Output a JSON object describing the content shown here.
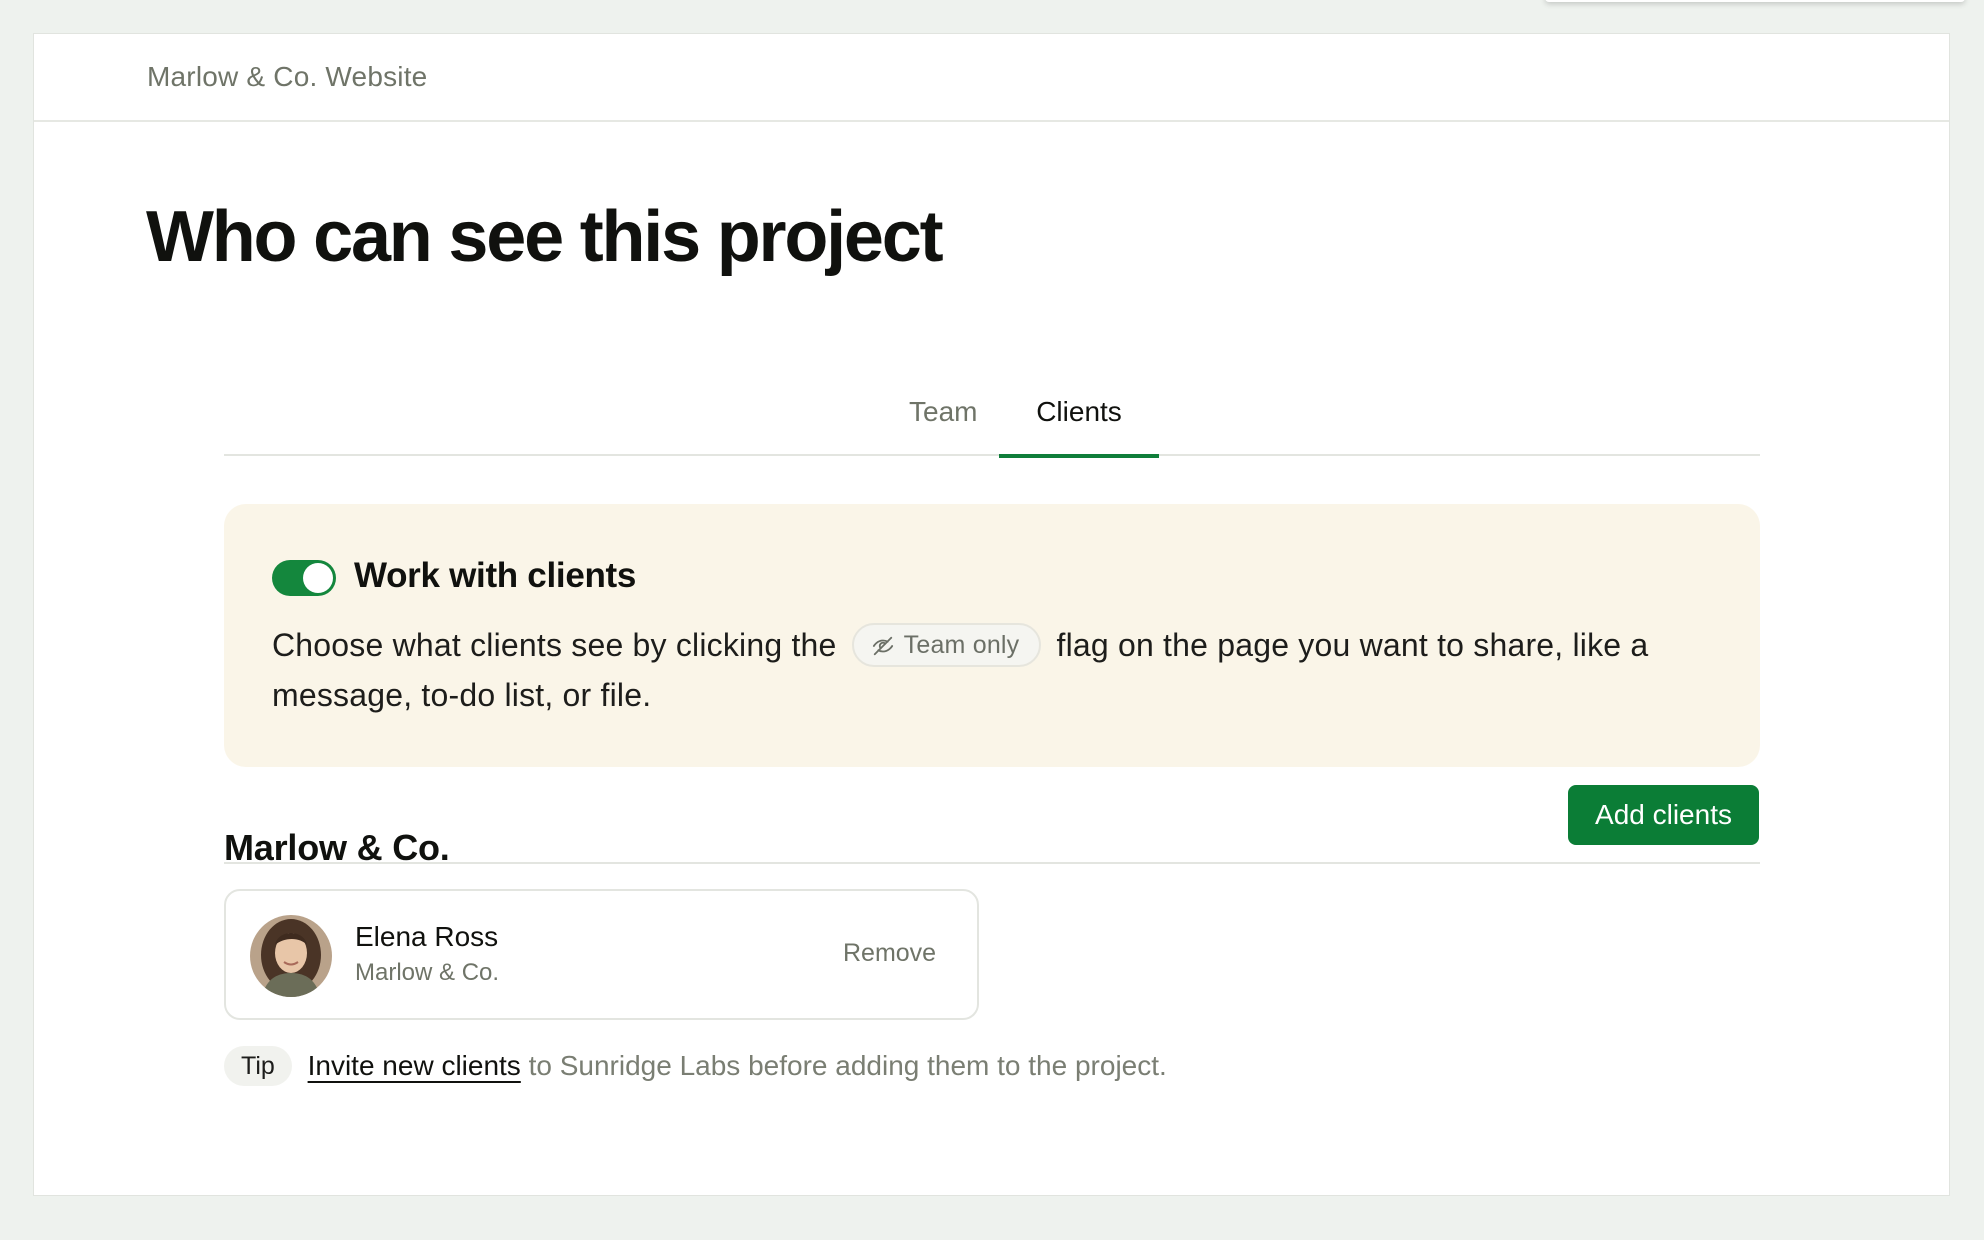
{
  "breadcrumb": "Marlow & Co. Website",
  "page_title": "Who can see this project",
  "tabs": [
    {
      "label": "Team",
      "active": false
    },
    {
      "label": "Clients",
      "active": true
    }
  ],
  "client_toggle": {
    "enabled": true,
    "heading": "Work with clients",
    "text_before": "Choose what clients see by clicking the",
    "flag_label": "Team only",
    "flag_icon": "eye-slash-icon",
    "text_after": "flag on the page you want to share, like a message, to-do list, or file."
  },
  "company": {
    "name": "Marlow & Co.",
    "add_button": "Add clients",
    "people": [
      {
        "name": "Elena Ross",
        "company": "Marlow & Co.",
        "action": "Remove"
      }
    ]
  },
  "tip": {
    "badge": "Tip",
    "link": "Invite new clients",
    "text": " to Sunridge Labs before adding them to the project."
  },
  "colors": {
    "accent_green": "#0b7d36",
    "info_background": "#faf5e8",
    "page_background": "#eef2ee"
  }
}
